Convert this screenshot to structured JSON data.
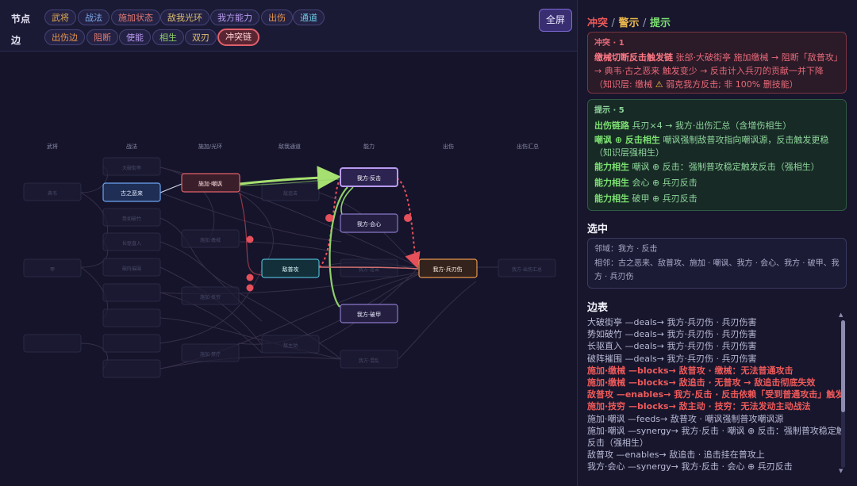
{
  "toolbar": {
    "node_label": "节点",
    "edge_label": "边",
    "node_chips": [
      {
        "label": "武将",
        "color": "#e0a950"
      },
      {
        "label": "战法",
        "color": "#7eaef0"
      },
      {
        "label": "施加状态",
        "color": "#e57a70"
      },
      {
        "label": "敌我光环",
        "color": "#e0c070"
      },
      {
        "label": "我方能力",
        "color": "#b99af0"
      },
      {
        "label": "出伤",
        "color": "#e8964c"
      },
      {
        "label": "通道",
        "color": "#6ec8e0"
      }
    ],
    "edge_chips": [
      {
        "label": "出伤边",
        "color": "#e8964c"
      },
      {
        "label": "阻断",
        "color": "#e57a70"
      },
      {
        "label": "使能",
        "color": "#b99af0"
      },
      {
        "label": "相生",
        "color": "#8fd06a"
      },
      {
        "label": "双刃",
        "color": "#e0c070"
      },
      {
        "label": "冲突链",
        "color": "#ffb0b0"
      }
    ],
    "fullscreen": "全屏"
  },
  "graph": {
    "columns": [
      "武将",
      "战法",
      "施加/光环",
      "敌我通道",
      "能力",
      "出伤",
      "出伤汇总"
    ],
    "nodes": {
      "n_dianwei": "典韦",
      "n_gzel": "古之恶来",
      "n_sjcf": "施加·嘲讽",
      "n_wfft": "我方·反击",
      "n_wfhx": "我方·会心",
      "n_dpg": "敌普攻",
      "n_wfbrs": "我方·兵刃伤",
      "n_wfpj": "我方·破甲",
      "n_dpjt": "大破街亭",
      "n_sjjx": "施加·缴械",
      "n_wfcs": "我方·出伤汇总"
    },
    "ghost": [
      "大破街亭",
      "甲",
      "势如破竹",
      "长驱直入",
      "破阵摧围",
      "施加·缴械",
      "施加·技穷",
      "施加·禁疗",
      "敌追击",
      "敌主动",
      "我方·连击",
      "我方·混乱",
      "我方·攻心",
      "我方·兵刃伤"
    ],
    "colors": {
      "conflict": "#e5505a",
      "synergy": "#8fd06a",
      "enable": "#b99af0"
    }
  },
  "panel": {
    "title": [
      "冲突",
      "警示",
      "提示"
    ],
    "title_sep": "/",
    "conflict_head": "冲突 · 1",
    "conflict_bold": "缴械切断反击触发链",
    "conflict_text": " 张郃·大破街亭 施加缴械 → 阻断「敌普攻」→ 典韦·古之恶来 触发变少 → 反击计入兵刃的贡献一并下降（知识层: 缴械 ",
    "conflict_warn": "⚠",
    "conflict_tail": " 弱克我方反击; 非 100% 删技能）",
    "hint_head": "提示 · 5",
    "hints": [
      {
        "b": "出伤链路",
        "t": " 兵刃×4 → 我方·出伤汇总（含增伤相生）"
      },
      {
        "b": "嘲讽 ⊕ 反击相生",
        "t": " 嘲讽强制敌普攻指向嘲讽源，反击触发更稳"
      },
      {
        "b": "",
        "t": "（知识层强相生）"
      },
      {
        "b": "能力相生",
        "t": " 嘲讽 ⊕ 反击：强制普攻稳定触发反击（强相生）"
      },
      {
        "b": "能力相生",
        "t": " 会心 ⊕ 兵刃反击"
      },
      {
        "b": "能力相生",
        "t": " 破甲 ⊕ 兵刃反击"
      }
    ],
    "selected_title": "选中",
    "selected_line1": "邻域：我方 · 反击",
    "selected_line2": "相邻：古之恶来、敌普攻、施加 · 嘲讽、我方 · 会心、我方 · 破甲、我方 · 兵刃伤",
    "edges_title": "边表",
    "edges": [
      {
        "t": "大破街亭 —deals→ 我方·兵刃伤 · 兵刃伤害",
        "bad": false
      },
      {
        "t": "势如破竹 —deals→ 我方·兵刃伤 · 兵刃伤害",
        "bad": false
      },
      {
        "t": "长驱直入 —deals→ 我方·兵刃伤 · 兵刃伤害",
        "bad": false
      },
      {
        "t": "破阵摧围 —deals→ 我方·兵刃伤 · 兵刃伤害",
        "bad": false
      },
      {
        "t": "施加·缴械 —blocks→ 敌普攻 · 缴械：无法普通攻击",
        "bad": true
      },
      {
        "t": "施加·缴械 —blocks→ 敌追击 · 无普攻 → 敌追击彻底失效",
        "bad": true
      },
      {
        "t": "敌普攻 —enables→ 我方·反击 · 反击依赖「受到普通攻击」触发",
        "bad": true
      },
      {
        "t": "施加·技穷 —blocks→ 敌主动 · 技穷：无法发动主动战法",
        "bad": true
      },
      {
        "t": "施加·嘲讽 —feeds→ 敌普攻 · 嘲讽强制普攻嘲讽源",
        "bad": false
      },
      {
        "t": "施加·嘲讽 —synergy→ 我方·反击 · 嘲讽 ⊕ 反击：强制普攻稳定触发",
        "bad": false
      },
      {
        "t": "反击（强相生）",
        "bad": false
      },
      {
        "t": "敌普攻 —enables→ 敌追击 · 追击挂在普攻上",
        "bad": false
      },
      {
        "t": "我方·会心 —synergy→ 我方·反击 · 会心 ⊕ 兵刃反击",
        "bad": false
      }
    ]
  }
}
